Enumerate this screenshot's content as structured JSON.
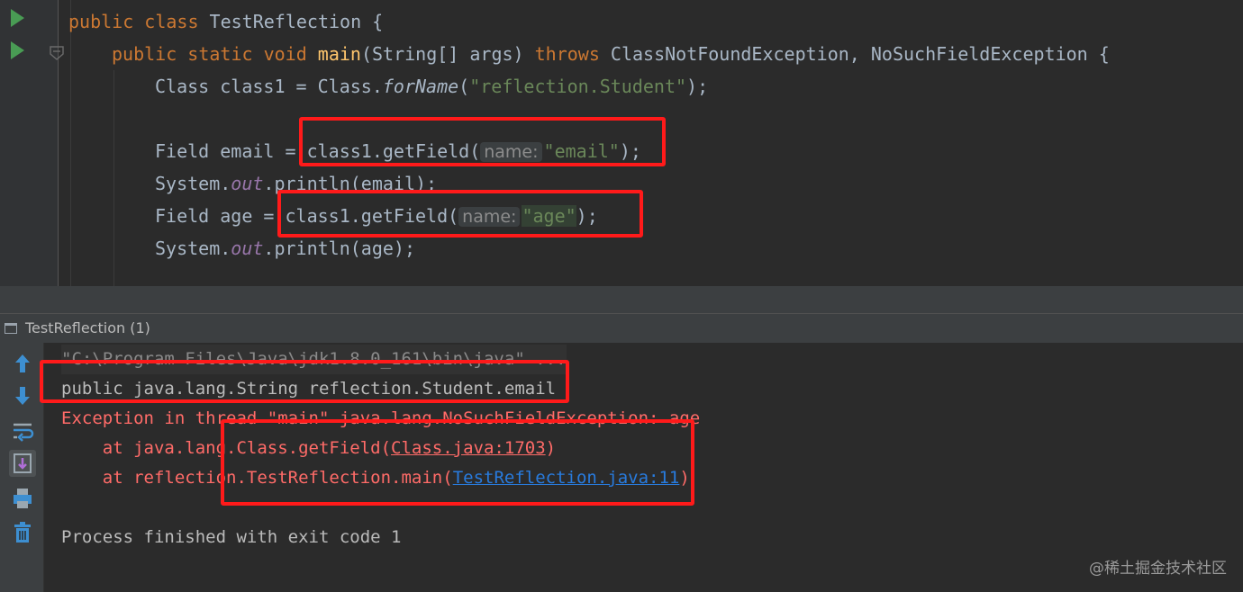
{
  "editor": {
    "line1": {
      "kw": "public class ",
      "name": "TestReflection",
      "rest": " {"
    },
    "line2": {
      "kw": "public static void ",
      "fn": "main",
      "params": "(String[] args) ",
      "throws": "throws",
      "exceptions": " ClassNotFoundException, NoSuchFieldException {"
    },
    "line3": {
      "pre": "Class class1 = Class.",
      "method": "forName",
      "open": "(",
      "str": "\"reflection.Student\"",
      "close": ");"
    },
    "line4": {
      "pre": "Field email = class1.getField(",
      "hint": "name:",
      "str": "\"email\"",
      "close": ");"
    },
    "line5": {
      "pre": "System.",
      "field": "out",
      "post": ".println(email);"
    },
    "line6": {
      "pre": "Field age = class1.getField(",
      "hint": "name:",
      "str": "\"age\"",
      "close": ");"
    },
    "line7": {
      "pre": "System.",
      "field": "out",
      "post": ".println(age);"
    }
  },
  "run_window": {
    "tab_title": "TestReflection (1)",
    "toolbar": [
      "up-arrow-icon",
      "down-arrow-icon",
      "soft-wrap-icon",
      "scroll-to-end-icon",
      "print-icon",
      "trash-icon"
    ]
  },
  "console": {
    "cmd": "\"C:\\Program Files\\Java\\jdk1.8.0_161\\bin\\java\" ...",
    "output": "public java.lang.String reflection.Student.email",
    "exception": "Exception in thread \"main\" java.lang.NoSuchFieldException: age",
    "trace1": {
      "prefix": "    at java.lang.Class.getField(",
      "link": "Class.java:1703",
      "suffix": ")"
    },
    "trace2": {
      "prefix": "    at reflection.TestReflection.main(",
      "link": "TestReflection.java:11",
      "suffix": ")"
    },
    "exit": "Process finished with exit code 1"
  },
  "watermark": "@稀土掘金技术社区",
  "colors": {
    "keyword": "#cc7832",
    "string": "#6a8759",
    "error": "#ff6b68",
    "annotation": "#ff1a1a",
    "link": "#287bde"
  }
}
